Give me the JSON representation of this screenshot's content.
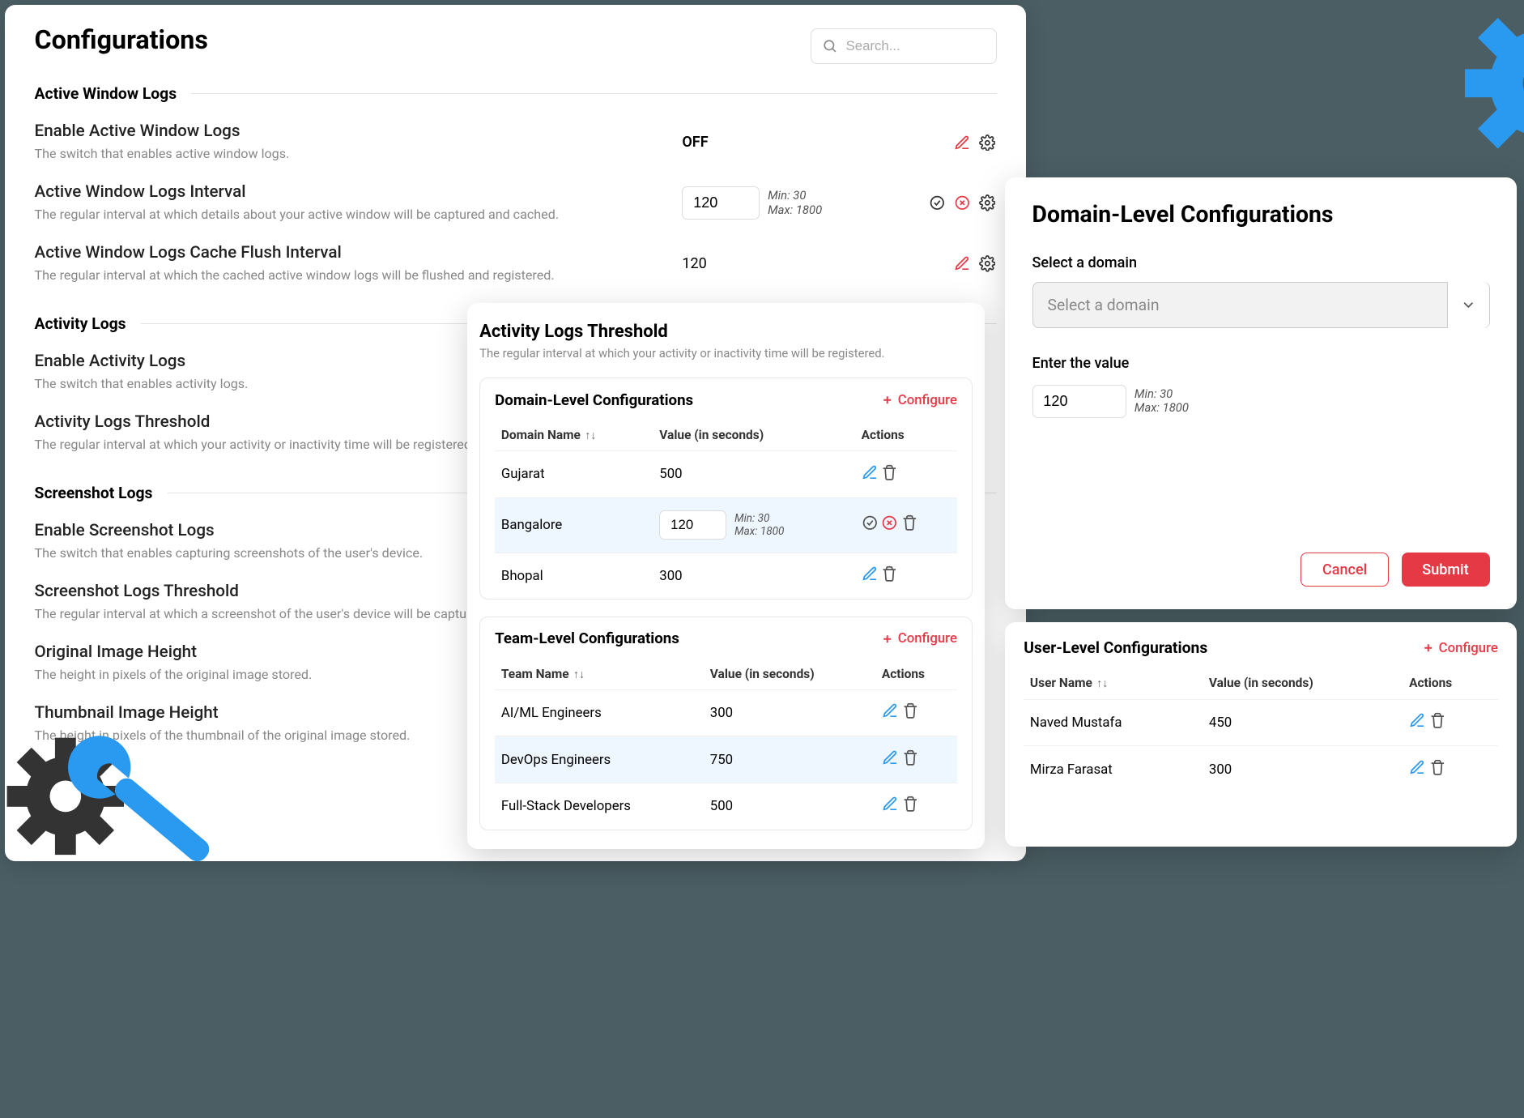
{
  "page_title": "Configurations",
  "search": {
    "placeholder": "Search..."
  },
  "sections": {
    "active_window": {
      "title": "Active Window Logs",
      "items": [
        {
          "title": "Enable Active Window Logs",
          "desc": "The switch that enables active window logs.",
          "value": "OFF",
          "edit_mode": false
        },
        {
          "title": "Active Window Logs Interval",
          "desc": "The regular interval at which details about your active window will be captured and cached.",
          "value": "120",
          "edit_mode": true,
          "min": "Min: 30",
          "max": "Max: 1800"
        },
        {
          "title": "Active Window Logs Cache Flush Interval",
          "desc": "The regular interval at which the cached active window logs will be flushed and registered.",
          "value": "120",
          "edit_mode": false
        }
      ]
    },
    "activity": {
      "title": "Activity Logs",
      "items": [
        {
          "title": "Enable Activity Logs",
          "desc": "The switch that enables activity logs."
        },
        {
          "title": "Activity Logs Threshold",
          "desc": "The regular interval at which your activity or inactivity time will be registered."
        }
      ]
    },
    "screenshot": {
      "title": "Screenshot Logs",
      "items": [
        {
          "title": "Enable Screenshot Logs",
          "desc": "The switch that enables capturing screenshots of the user's device."
        },
        {
          "title": "Screenshot Logs Threshold",
          "desc": "The regular interval at which a screenshot of the user's device will be captured."
        },
        {
          "title": "Original Image Height",
          "desc": "The height in pixels of the original image stored."
        },
        {
          "title": "Thumbnail Image Height",
          "desc": "The height in pixels of the thumbnail of the original image stored."
        }
      ]
    }
  },
  "detail": {
    "title": "Activity Logs Threshold",
    "sub": "The regular interval at which your activity or inactivity time will be registered.",
    "domain_level": {
      "title": "Domain-Level Configurations",
      "configure": "Configure",
      "col_name": "Domain Name",
      "col_value": "Value (in seconds)",
      "col_actions": "Actions",
      "rows": [
        {
          "name": "Gujarat",
          "value": "500",
          "editing": false
        },
        {
          "name": "Bangalore",
          "value": "120",
          "editing": true,
          "min": "Min: 30",
          "max": "Max: 1800"
        },
        {
          "name": "Bhopal",
          "value": "300",
          "editing": false
        }
      ]
    },
    "team_level": {
      "title": "Team-Level Configurations",
      "configure": "Configure",
      "col_name": "Team Name",
      "col_value": "Value (in seconds)",
      "col_actions": "Actions",
      "rows": [
        {
          "name": "AI/ML Engineers",
          "value": "300"
        },
        {
          "name": "DevOps Engineers",
          "value": "750"
        },
        {
          "name": "Full-Stack Developers",
          "value": "500"
        }
      ]
    }
  },
  "right": {
    "title": "Domain-Level Configurations",
    "select_label": "Select a domain",
    "select_placeholder": "Select a domain",
    "value_label": "Enter the value",
    "value": "120",
    "min": "Min: 30",
    "max": "Max: 1800",
    "cancel": "Cancel",
    "submit": "Submit"
  },
  "user_level": {
    "title": "User-Level Configurations",
    "configure": "Configure",
    "col_name": "User Name",
    "col_value": "Value (in seconds)",
    "col_actions": "Actions",
    "rows": [
      {
        "name": "Naved Mustafa",
        "value": "450"
      },
      {
        "name": "Mirza Farasat",
        "value": "300"
      }
    ]
  },
  "colors": {
    "danger": "#e63946",
    "accent_blue": "#2a99f0",
    "gear_blue": "#2a99f0",
    "gear_teal": "#1dbf9f",
    "gear_yellow": "#f5b015",
    "gear_dark": "#333333"
  }
}
